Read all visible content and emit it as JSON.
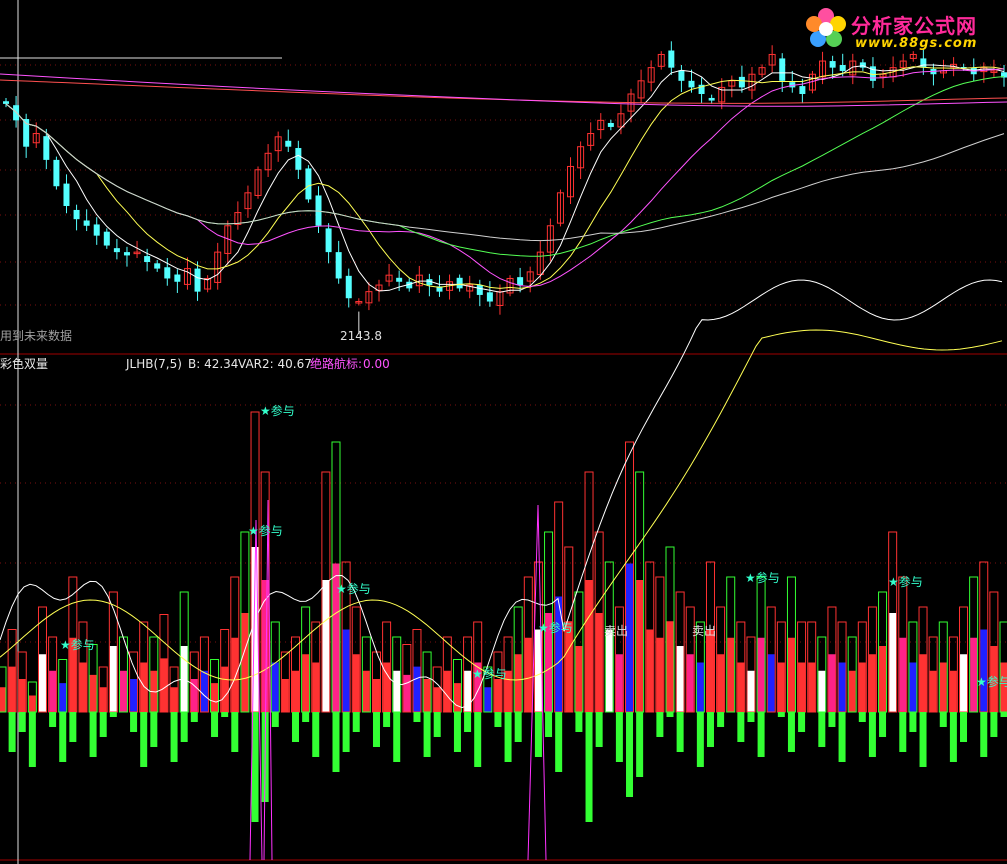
{
  "upper_panel": {
    "low_marker": "2143.8",
    "future_data_note": "用到未来数据"
  },
  "lower_panel": {
    "indicator_name": "彩色双量",
    "readout_jlhb": "JLHB(7,5)",
    "readout_b": "B: 42.34",
    "readout_var2": "VAR2: 40.67",
    "readout_jlhb_label": "绝路航标:",
    "readout_jlhb_value": "0.00",
    "signal_label": "★参与",
    "exit_label": "卖出"
  },
  "watermark": {
    "brand": "分析家公式网",
    "url": "www.88gs.com"
  },
  "colors": {
    "up": "#ff3232",
    "down": "#54ffff",
    "ma_white": "#ffffff",
    "ma_yellow": "#ffff54",
    "ma_magenta": "#ff54ff",
    "ma_green": "#54ff54",
    "vol_green": "#33ff33",
    "vol_blue": "#2020ff",
    "vol_pink": "#ff2288",
    "signal": "#33ffcc",
    "panel_border": "#a00000"
  },
  "chart_data": [
    {
      "type": "candlestick",
      "annotations": [
        "2143.8"
      ],
      "low_value": 2143.8,
      "close": [
        2.75,
        2.7,
        2.62,
        2.66,
        2.58,
        2.5,
        2.44,
        2.4,
        2.38,
        2.35,
        2.32,
        2.3,
        2.29,
        2.3,
        2.27,
        2.25,
        2.22,
        2.21,
        2.25,
        2.18,
        2.22,
        2.3,
        2.38,
        2.42,
        2.48,
        2.55,
        2.6,
        2.65,
        2.62,
        2.55,
        2.46,
        2.38,
        2.3,
        2.22,
        2.16,
        2.15,
        2.18,
        2.2,
        2.23,
        2.21,
        2.19,
        2.23,
        2.2,
        2.18,
        2.21,
        2.19,
        2.2,
        2.17,
        2.15,
        2.18,
        2.22,
        2.2,
        2.24,
        2.3,
        2.38,
        2.48,
        2.56,
        2.62,
        2.66,
        2.7,
        2.68,
        2.72,
        2.78,
        2.82,
        2.86,
        2.9,
        2.86,
        2.82,
        2.8,
        2.78,
        2.76,
        2.8,
        2.82,
        2.8,
        2.84,
        2.86,
        2.9,
        2.82,
        2.8,
        2.78,
        2.84,
        2.88,
        2.86,
        2.85,
        2.88,
        2.86,
        2.82,
        2.84,
        2.86,
        2.88,
        2.9,
        2.86,
        2.84,
        2.85,
        2.87,
        2.86,
        2.84,
        2.86,
        2.85,
        2.83
      ]
    },
    {
      "type": "bar",
      "series": [
        {
          "name": "JLHB(7,5)",
          "values": [
            0.3,
            0.55,
            0.4,
            0.2,
            0.7,
            0.5,
            0.35,
            0.9,
            0.6,
            0.45,
            0.3,
            0.8,
            0.5,
            0.4,
            0.6,
            0.5,
            0.65,
            0.3,
            0.8,
            0.4,
            0.5,
            0.35,
            0.55,
            0.9,
            1.2,
            2.0,
            1.6,
            0.6,
            0.4,
            0.5,
            0.7,
            0.6,
            1.6,
            1.8,
            1.0,
            0.7,
            0.5,
            0.4,
            0.6,
            0.5,
            0.45,
            0.55,
            0.4,
            0.3,
            0.5,
            0.35,
            0.5,
            0.6,
            0.3,
            0.4,
            0.5,
            0.7,
            0.9,
            1.0,
            1.2,
            1.4,
            1.1,
            0.8,
            1.6,
            1.2,
            1.0,
            0.7,
            1.8,
            1.6,
            1.0,
            0.9,
            1.1,
            0.8,
            0.7,
            0.6,
            1.0,
            0.7,
            0.9,
            0.6,
            0.5,
            0.9,
            0.7,
            0.6,
            0.9,
            0.6,
            0.6,
            0.5,
            0.7,
            0.6,
            0.5,
            0.6,
            0.7,
            0.8,
            1.2,
            0.9,
            0.6,
            0.7,
            0.5,
            0.6,
            0.5,
            0.7,
            0.9,
            1.0,
            0.8,
            0.6
          ]
        }
      ],
      "readouts": {
        "B": 42.34,
        "VAR2": 40.67,
        "绝路航标": 0.0
      }
    }
  ]
}
